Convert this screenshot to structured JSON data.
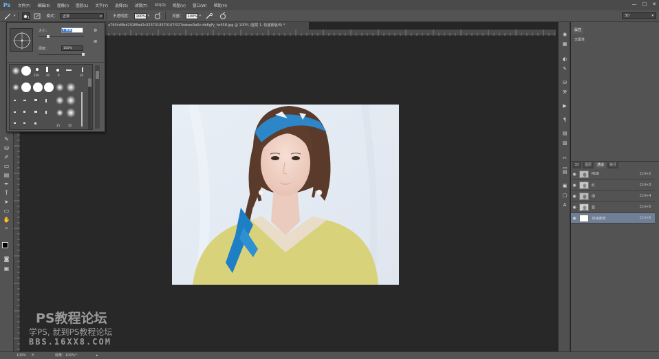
{
  "app": {
    "logo": "Ps"
  },
  "menu": [
    "文件(F)",
    "编辑(E)",
    "图像(I)",
    "图层(L)",
    "文字(Y)",
    "选择(S)",
    "滤镜(T)",
    "3D(D)",
    "视图(V)",
    "窗口(W)",
    "帮助(H)"
  ],
  "window_controls": [
    "—",
    "□",
    "✕"
  ],
  "options": {
    "brush_size": "1",
    "mode_label": "模式：",
    "mode_value": "正常",
    "opacity_label": "不透明度：",
    "opacity_value": "100%",
    "flow_label": "流量：",
    "flow_value": "100%"
  },
  "workspace": "3D",
  "brush_popup": {
    "size_label": "大小：",
    "size_value": "1 像素",
    "hardness_label": "硬度：",
    "hardness_value": "100%",
    "preset_numbers": [
      "220",
      "40",
      "9",
      "20",
      "25",
      "50"
    ]
  },
  "document_tab": "a7994d9bd292f8bd2c3237318370167f327debec9a6c-db8gFy_fw658.jpg @ 100% (图层 1, 快速蒙版/8) *",
  "panels": {
    "properties_tab": "属性",
    "properties_text": "无属性",
    "tabs": [
      "3D",
      "图层",
      "通道",
      "路径"
    ],
    "active_tab": "通道",
    "channels": [
      {
        "name": "RGB",
        "shortcut": "Ctrl+2",
        "selected": false
      },
      {
        "name": "红",
        "shortcut": "Ctrl+3",
        "selected": false
      },
      {
        "name": "绿",
        "shortcut": "Ctrl+4",
        "selected": false
      },
      {
        "name": "蓝",
        "shortcut": "Ctrl+5",
        "selected": false
      },
      {
        "name": "快速蒙版",
        "shortcut": "Ctrl+6",
        "selected": true
      }
    ]
  },
  "status": {
    "zoom": "100%",
    "doc_info": "效果：100%*"
  },
  "watermark": {
    "line1": "PS教程论坛",
    "line2": "学PS, 就到PS教程论坛",
    "line3": "BBS.16XX8.COM"
  },
  "colors": {
    "accent": "#6e7f96",
    "panel": "#535353",
    "canvas": "#282828",
    "ps_blue": "#6fb5ff"
  },
  "icons": [
    "brush-icon",
    "move-icon",
    "marquee-icon",
    "lasso-icon",
    "quick-select-icon",
    "crop-icon",
    "eyedropper-icon",
    "healing-icon",
    "brush-tool-icon",
    "clone-icon",
    "history-brush-icon",
    "eraser-icon",
    "gradient-icon",
    "blur-icon",
    "dodge-icon",
    "pen-icon",
    "type-icon",
    "path-select-icon",
    "shape-icon",
    "hand-icon",
    "zoom-icon",
    "eye-icon"
  ]
}
